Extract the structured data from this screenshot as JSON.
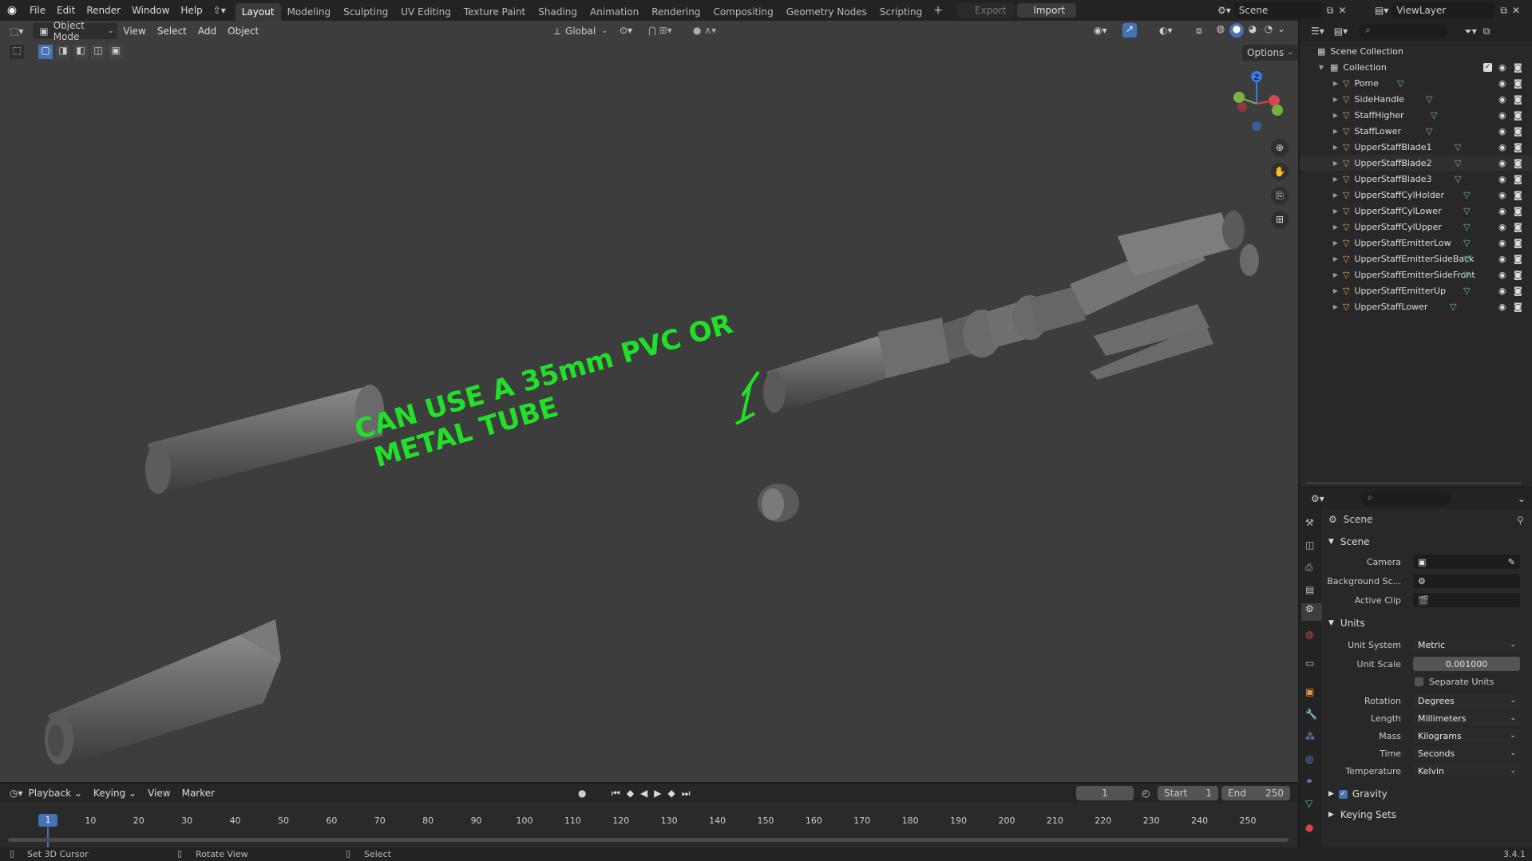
{
  "menu": {
    "file": "File",
    "edit": "Edit",
    "render": "Render",
    "window": "Window",
    "help": "Help"
  },
  "workspaces": [
    "Layout",
    "Modeling",
    "Sculpting",
    "UV Editing",
    "Texture Paint",
    "Shading",
    "Animation",
    "Rendering",
    "Compositing",
    "Geometry Nodes",
    "Scripting"
  ],
  "active_workspace": "Layout",
  "topbar": {
    "export": "Export",
    "import": "Import",
    "scene": "Scene",
    "view_layer": "ViewLayer"
  },
  "viewport_header": {
    "mode": "Object Mode",
    "view": "View",
    "select": "Select",
    "add": "Add",
    "object": "Object",
    "orientation": "Global",
    "options": "Options"
  },
  "annotation": {
    "line1": "CAN USE A 35mm PVC OR",
    "line2": "METAL TUBE",
    "color": "#22e02a"
  },
  "outliner": {
    "scene_collection": "Scene Collection",
    "collection": "Collection",
    "items": [
      "Pome",
      "SideHandle",
      "StaffHigher",
      "StaffLower",
      "UpperStaffBlade1",
      "UpperStaffBlade2",
      "UpperStaffBlade3",
      "UpperStaffCylHolder",
      "UpperStaffCylLower",
      "UpperStaffCylUpper",
      "UpperStaffEmitterLow",
      "UpperStaffEmitterSideBack",
      "UpperStaffEmitterSideFront",
      "UpperStaffEmitterUp",
      "UpperStaffLower"
    ]
  },
  "properties": {
    "title": "Scene",
    "scene_section": "Scene",
    "camera_label": "Camera",
    "background_label": "Background Sc...",
    "active_clip_label": "Active Clip",
    "units_section": "Units",
    "unit_system_label": "Unit System",
    "unit_system": "Metric",
    "unit_scale_label": "Unit Scale",
    "unit_scale": "0.001000",
    "separate_units": "Separate Units",
    "rotation_label": "Rotation",
    "rotation": "Degrees",
    "length_label": "Length",
    "length": "Millimeters",
    "mass_label": "Mass",
    "mass": "Kilograms",
    "time_label": "Time",
    "time": "Seconds",
    "temperature_label": "Temperature",
    "temperature": "Kelvin",
    "gravity": "Gravity",
    "keying_sets": "Keying Sets"
  },
  "timeline": {
    "playback": "Playback",
    "keying": "Keying",
    "view": "View",
    "marker": "Marker",
    "current_frame": "1",
    "start_label": "Start",
    "start": "1",
    "end_label": "End",
    "end": "250",
    "ticks": [
      "1",
      "10",
      "20",
      "30",
      "40",
      "50",
      "60",
      "70",
      "80",
      "90",
      "100",
      "110",
      "120",
      "130",
      "140",
      "150",
      "160",
      "170",
      "180",
      "190",
      "200",
      "210",
      "220",
      "230",
      "240",
      "250"
    ]
  },
  "statusbar": {
    "left": "Set 3D Cursor",
    "middle": "Rotate View",
    "right": "Select",
    "version": "3.4.1"
  },
  "colors": {
    "accent": "#4772b3",
    "object_orange": "#e8984c",
    "mesh_green": "#5fc86a",
    "annotation": "#22e02a"
  }
}
